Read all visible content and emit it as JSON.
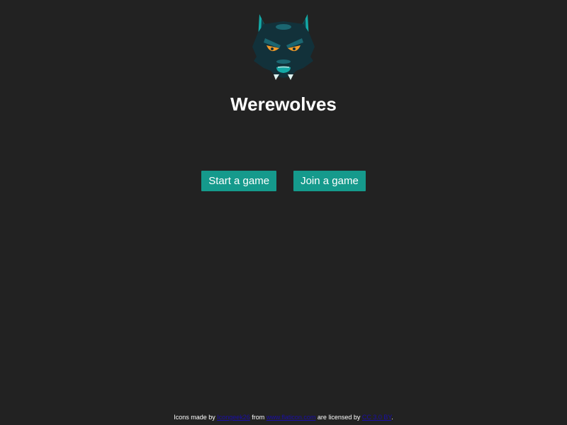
{
  "app": {
    "title": "Werewolves",
    "logo_icon": "werewolf-head-icon"
  },
  "actions": {
    "start_label": "Start a game",
    "join_label": "Join a game"
  },
  "footer": {
    "prefix": "Icons made by",
    "author_link": "Icongeek26",
    "from_text": "from",
    "site_link": "www.flaticon.com",
    "license_text": "are licensed by",
    "license_link": "CC 3.0 BY",
    "suffix": "."
  },
  "colors": {
    "background": "#222222",
    "button": "#159a8c",
    "link": "#1a0dab"
  }
}
